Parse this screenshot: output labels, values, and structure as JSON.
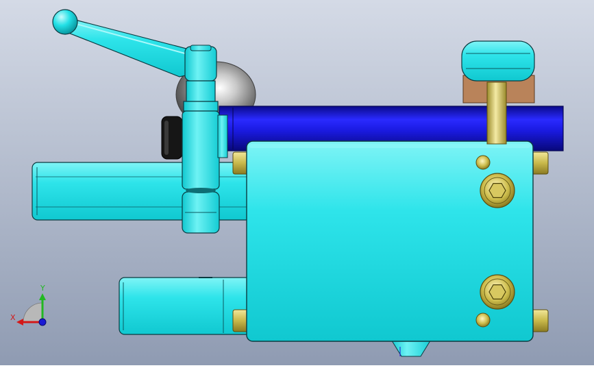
{
  "scene": {
    "background_top": "#d4dae6",
    "background_bottom": "#8f9bb2"
  },
  "model": {
    "body_color": "#22e0e6",
    "rod_color": "#1414d6",
    "chrome_color": "#a8a8a8",
    "brass_color": "#c8b84a",
    "wood_color": "#b9835a",
    "knob_color": "#141414"
  },
  "triad": {
    "x_label": "X",
    "y_label": "Y",
    "x_color": "#d41818",
    "y_color": "#22b822",
    "z_color": "#1a1ad4"
  }
}
